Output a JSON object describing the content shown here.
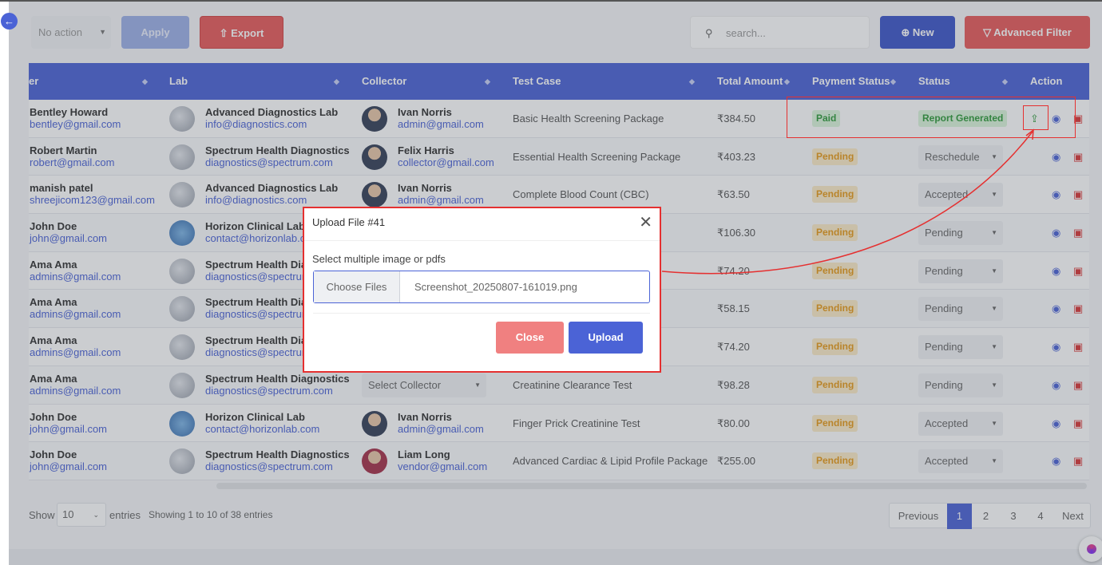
{
  "toolbar": {
    "bulk_action": "No action",
    "apply": "Apply",
    "export": "Export",
    "search_placeholder": "search...",
    "new": "New",
    "advanced_filter": "Advanced Filter"
  },
  "table": {
    "columns": [
      "er",
      "Lab",
      "Collector",
      "Test Case",
      "Total Amount",
      "Payment Status",
      "Status",
      "Action"
    ],
    "rows": [
      {
        "name": "Bentley Howard",
        "email": "bentley@gmail.com",
        "lab": "Advanced Diagnostics Lab",
        "lab_email": "info@diagnostics.com",
        "collector": "Ivan Norris",
        "collector_email": "admin@gmail.com",
        "test": "Basic Health Screening Package",
        "amount": "₹384.50",
        "payment": "Paid",
        "status": "Report Generated"
      },
      {
        "name": "Robert Martin",
        "email": "robert@gmail.com",
        "lab": "Spectrum Health Diagnostics",
        "lab_email": "diagnostics@spectrum.com",
        "collector": "Felix Harris",
        "collector_email": "collector@gmail.com",
        "test": "Essential Health Screening Package",
        "amount": "₹403.23",
        "payment": "Pending",
        "status": "Reschedule"
      },
      {
        "name": "manish patel",
        "email": "shreejicom123@gmail.com",
        "lab": "Advanced Diagnostics Lab",
        "lab_email": "info@diagnostics.com",
        "collector": "Ivan Norris",
        "collector_email": "admin@gmail.com",
        "test": "Complete Blood Count (CBC)",
        "amount": "₹63.50",
        "payment": "Pending",
        "status": "Accepted"
      },
      {
        "name": "John Doe",
        "email": "john@gmail.com",
        "lab": "Horizon Clinical Lab",
        "lab_email": "contact@horizonlab.co",
        "collector": "",
        "collector_email": "",
        "test": "",
        "amount": "₹106.30",
        "payment": "Pending",
        "status": "Pending"
      },
      {
        "name": "Ama Ama",
        "email": "admins@gmail.com",
        "lab": "Spectrum Health Diag",
        "lab_email": "diagnostics@spectrum",
        "collector": "",
        "collector_email": "",
        "test": "",
        "amount": "₹74.20",
        "payment": "Pending",
        "status": "Pending"
      },
      {
        "name": "Ama Ama",
        "email": "admins@gmail.com",
        "lab": "Spectrum Health Diag",
        "lab_email": "diagnostics@spectrum",
        "collector": "",
        "collector_email": "",
        "test": "",
        "amount": "₹58.15",
        "payment": "Pending",
        "status": "Pending"
      },
      {
        "name": "Ama Ama",
        "email": "admins@gmail.com",
        "lab": "Spectrum Health Diag",
        "lab_email": "diagnostics@spectrum",
        "collector": "",
        "collector_email": "",
        "test": "",
        "amount": "₹74.20",
        "payment": "Pending",
        "status": "Pending"
      },
      {
        "name": "Ama Ama",
        "email": "admins@gmail.com",
        "lab": "Spectrum Health Diagnostics",
        "lab_email": "diagnostics@spectrum.com",
        "collector_select": "Select Collector",
        "test": "Creatinine Clearance Test",
        "amount": "₹98.28",
        "payment": "Pending",
        "status": "Pending"
      },
      {
        "name": "John Doe",
        "email": "john@gmail.com",
        "lab": "Horizon Clinical Lab",
        "lab_email": "contact@horizonlab.com",
        "collector": "Ivan Norris",
        "collector_email": "admin@gmail.com",
        "test": "Finger Prick Creatinine Test",
        "amount": "₹80.00",
        "payment": "Pending",
        "status": "Accepted"
      },
      {
        "name": "John Doe",
        "email": "john@gmail.com",
        "lab": "Spectrum Health Diagnostics",
        "lab_email": "diagnostics@spectrum.com",
        "collector": "Liam Long",
        "collector_email": "vendor@gmail.com",
        "test": "Advanced Cardiac & Lipid Profile Package",
        "amount": "₹255.00",
        "payment": "Pending",
        "status": "Accepted"
      }
    ]
  },
  "footer": {
    "show": "Show",
    "page_size": "10",
    "entries": "entries",
    "showing": "Showing 1 to 10 of 38 entries",
    "previous": "Previous",
    "pages": [
      "1",
      "2",
      "3",
      "4"
    ],
    "next": "Next"
  },
  "modal": {
    "title": "Upload File #41",
    "label": "Select multiple image or pdfs",
    "choose": "Choose Files",
    "filename": "Screenshot_20250807-161019.png",
    "close": "Close",
    "upload": "Upload"
  },
  "colors": {
    "primary": "#4b63d6",
    "danger": "#e85b5b",
    "annotation": "#e53030"
  }
}
